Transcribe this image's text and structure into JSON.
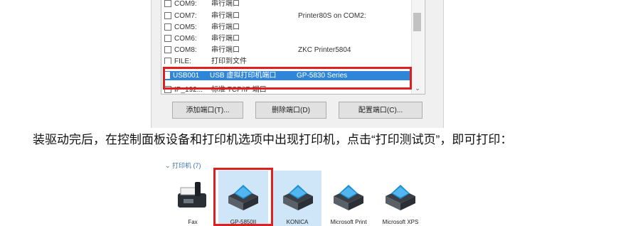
{
  "port_list": {
    "rows": [
      {
        "checked": false,
        "port": "COM9:",
        "desc": "串行端口",
        "printer": ""
      },
      {
        "checked": false,
        "port": "COM7:",
        "desc": "串行端口",
        "printer": "Printer80S on COM2:"
      },
      {
        "checked": false,
        "port": "COM5:",
        "desc": "串行端口",
        "printer": ""
      },
      {
        "checked": false,
        "port": "COM6:",
        "desc": "串行端口",
        "printer": ""
      },
      {
        "checked": false,
        "port": "COM8:",
        "desc": "串行端口",
        "printer": "ZKC Printer5804"
      },
      {
        "checked": false,
        "port": "FILE:",
        "desc": "打印到文件",
        "printer": ""
      },
      {
        "checked": true,
        "port": "USB001",
        "desc": "USB 虚拟打印机端口",
        "printer": "GP-5830 Series"
      },
      {
        "checked": false,
        "port": "IP_192...",
        "desc": "标准 TCP/IP 端口",
        "printer": ""
      }
    ]
  },
  "buttons": {
    "add_port": "添加端口(T)...",
    "delete_port": "删除端口(D)",
    "configure_port": "配置端口(C)..."
  },
  "instruction": {
    "text": "装驱动完后，在控制面板设备和打印机选项中出现打印机，点击“打印测试页”，即可打印："
  },
  "printers": {
    "group_title": "⌄ 打印机 (7)",
    "items": [
      {
        "label": "Fax",
        "icon": "fax-icon"
      },
      {
        "label": "GP-5850II",
        "icon": "printer-icon"
      },
      {
        "label": "KONICA",
        "icon": "printer-icon"
      },
      {
        "label": "Microsoft Print",
        "icon": "printer-icon"
      },
      {
        "label": "Microsoft XPS",
        "icon": "printer-icon"
      }
    ]
  },
  "colors": {
    "highlight": "#e02020",
    "selection": "#2f86d9"
  }
}
